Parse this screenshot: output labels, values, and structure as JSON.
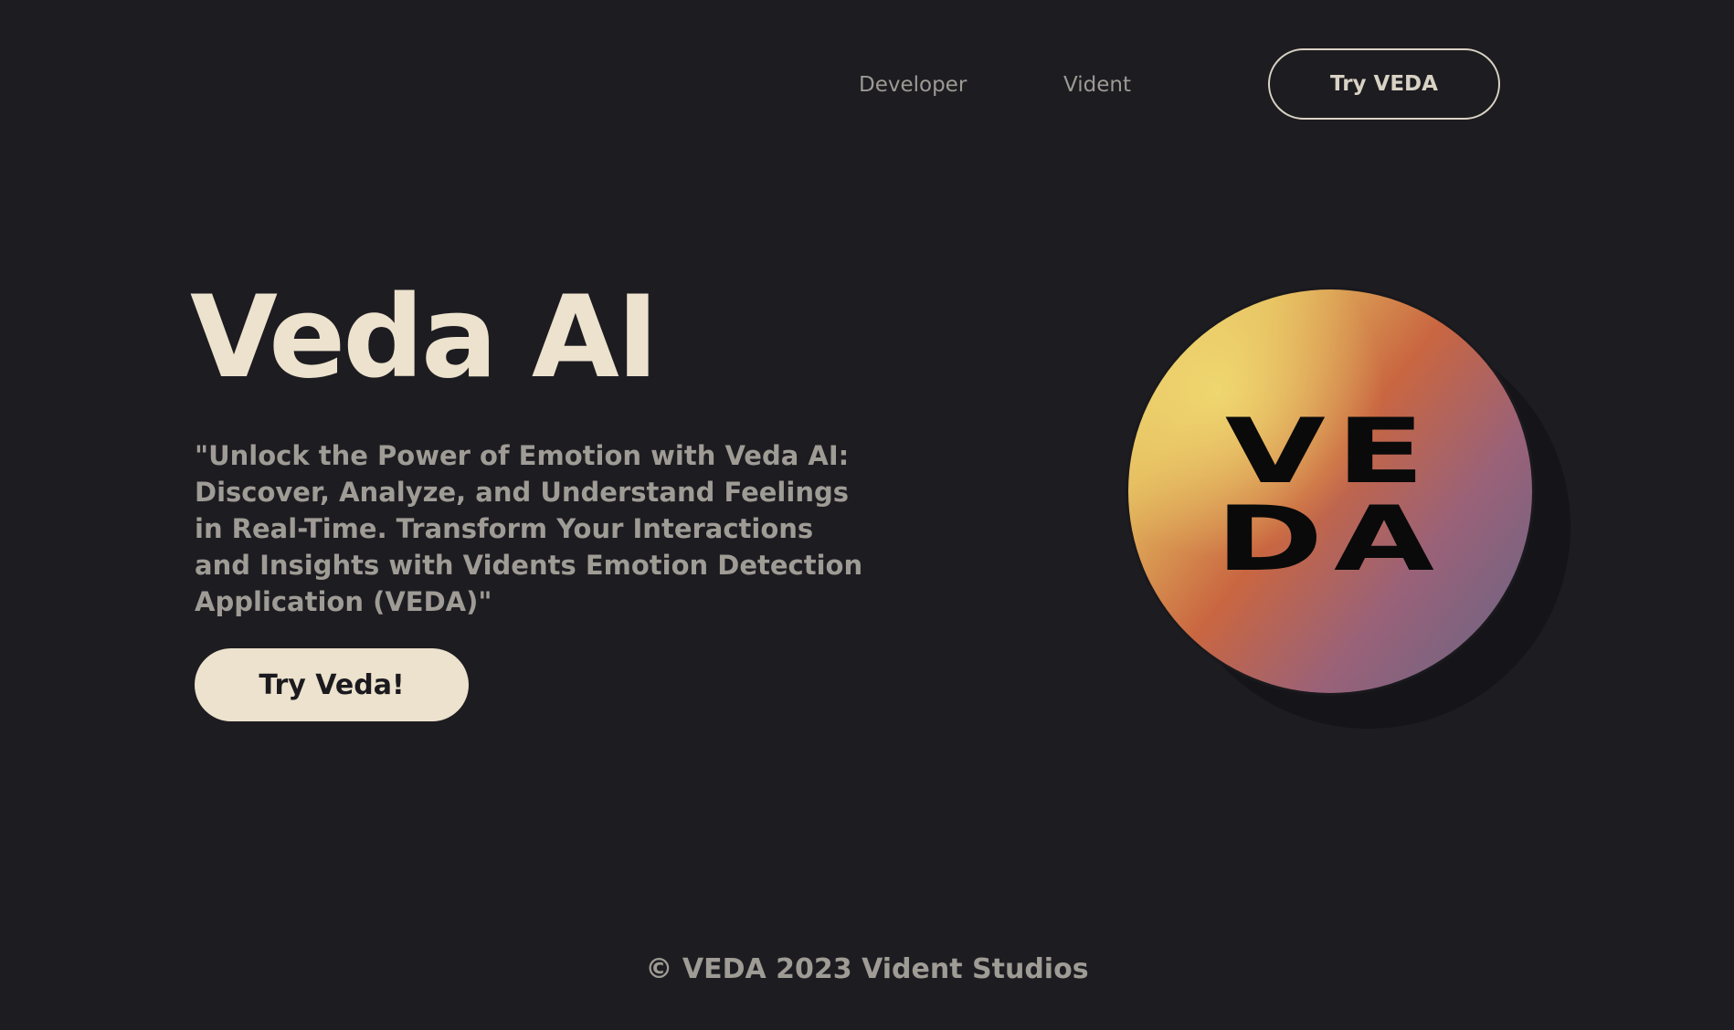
{
  "nav": {
    "links": [
      "Developer",
      "Vident"
    ],
    "cta": "Try VEDA"
  },
  "hero": {
    "title": "Veda AI",
    "description": "\"Unlock the Power of Emotion with Veda AI: Discover, Analyze, and Understand Feelings in Real-Time. Transform Your Interactions and Insights with Vidents Emotion Detection Application (VEDA)\"",
    "cta": "Try Veda!"
  },
  "logo": {
    "line1": "VE",
    "line2": "DA"
  },
  "footer": {
    "text": "© VEDA 2023 Vident Studios"
  },
  "colors": {
    "background": "#1d1c21",
    "title": "#ece2cd",
    "body_text": "#9f9b95",
    "button_fill": "#ece2cd",
    "orb_gradient": [
      "#ead174",
      "#c96641",
      "#636487"
    ]
  }
}
